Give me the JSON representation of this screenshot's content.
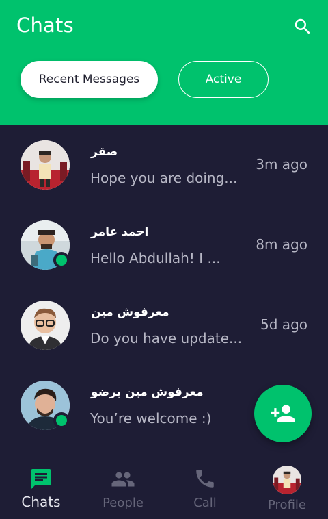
{
  "header": {
    "title": "Chats",
    "tabs": [
      {
        "label": "Recent Messages",
        "active": true
      },
      {
        "label": "Active",
        "active": false
      }
    ]
  },
  "chats": [
    {
      "name": "صقر",
      "message": "Hope you are doing...",
      "time": "3m ago",
      "online": false
    },
    {
      "name": "احمد عامر",
      "message": "Hello Abdullah! I ...",
      "time": "8m ago",
      "online": true
    },
    {
      "name": "معرفوش مين",
      "message": "Do you have update...",
      "time": "5d ago",
      "online": false
    },
    {
      "name": "معرفوش مين برضو",
      "message": "You’re welcome :)",
      "time": "",
      "online": true
    }
  ],
  "bottom_nav": [
    {
      "label": "Chats",
      "icon": "chat-bubble-icon",
      "active": true
    },
    {
      "label": "People",
      "icon": "people-icon",
      "active": false
    },
    {
      "label": "Call",
      "icon": "phone-icon",
      "active": false
    },
    {
      "label": "Profile",
      "icon": "profile-avatar",
      "active": false
    }
  ],
  "colors": {
    "primary": "#00c26d",
    "background": "#1e1d35",
    "muted_text": "#b7b7c5",
    "inactive_nav": "#66667a"
  }
}
